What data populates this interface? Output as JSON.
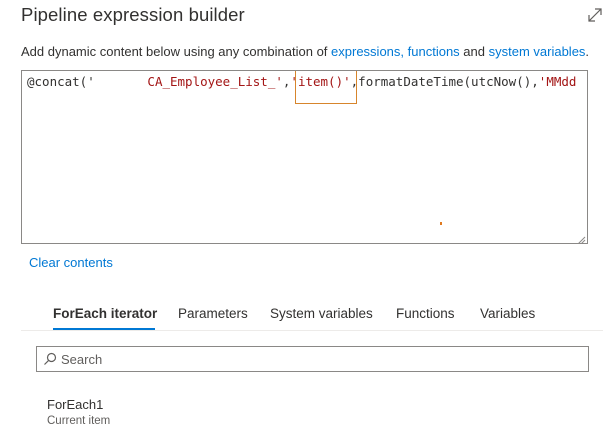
{
  "dialog": {
    "title": "Pipeline expression builder"
  },
  "description": {
    "prefix": "Add dynamic content below using any combination of ",
    "link_expressions": "expressions,",
    "link_functions": "functions",
    "middle": " and ",
    "link_system_variables": "system variables",
    "suffix": "."
  },
  "editor": {
    "code_prefix": "@concat('",
    "code_gap": "       ",
    "code_str1": "CA_Employee_List_'",
    "code_comma1": ",",
    "code_str2": "'item()'",
    "code_rest": ",formatDateTime(utcNow(),",
    "code_str3": "'MMdd"
  },
  "actions": {
    "clear_label": "Clear contents"
  },
  "tabs": [
    {
      "label": "ForEach iterator",
      "active": true
    },
    {
      "label": "Parameters",
      "active": false
    },
    {
      "label": "System variables",
      "active": false
    },
    {
      "label": "Functions",
      "active": false
    },
    {
      "label": "Variables",
      "active": false
    }
  ],
  "search": {
    "placeholder": "Search",
    "value": ""
  },
  "list": [
    {
      "title": "ForEach1",
      "subtitle": "Current item"
    }
  ],
  "colors": {
    "accent": "#0078d4",
    "string": "#a31515",
    "highlight_border": "#d7852c"
  },
  "icons": {
    "expand": "expand-icon",
    "search": "search-icon",
    "resize": "resize-grip-icon"
  }
}
